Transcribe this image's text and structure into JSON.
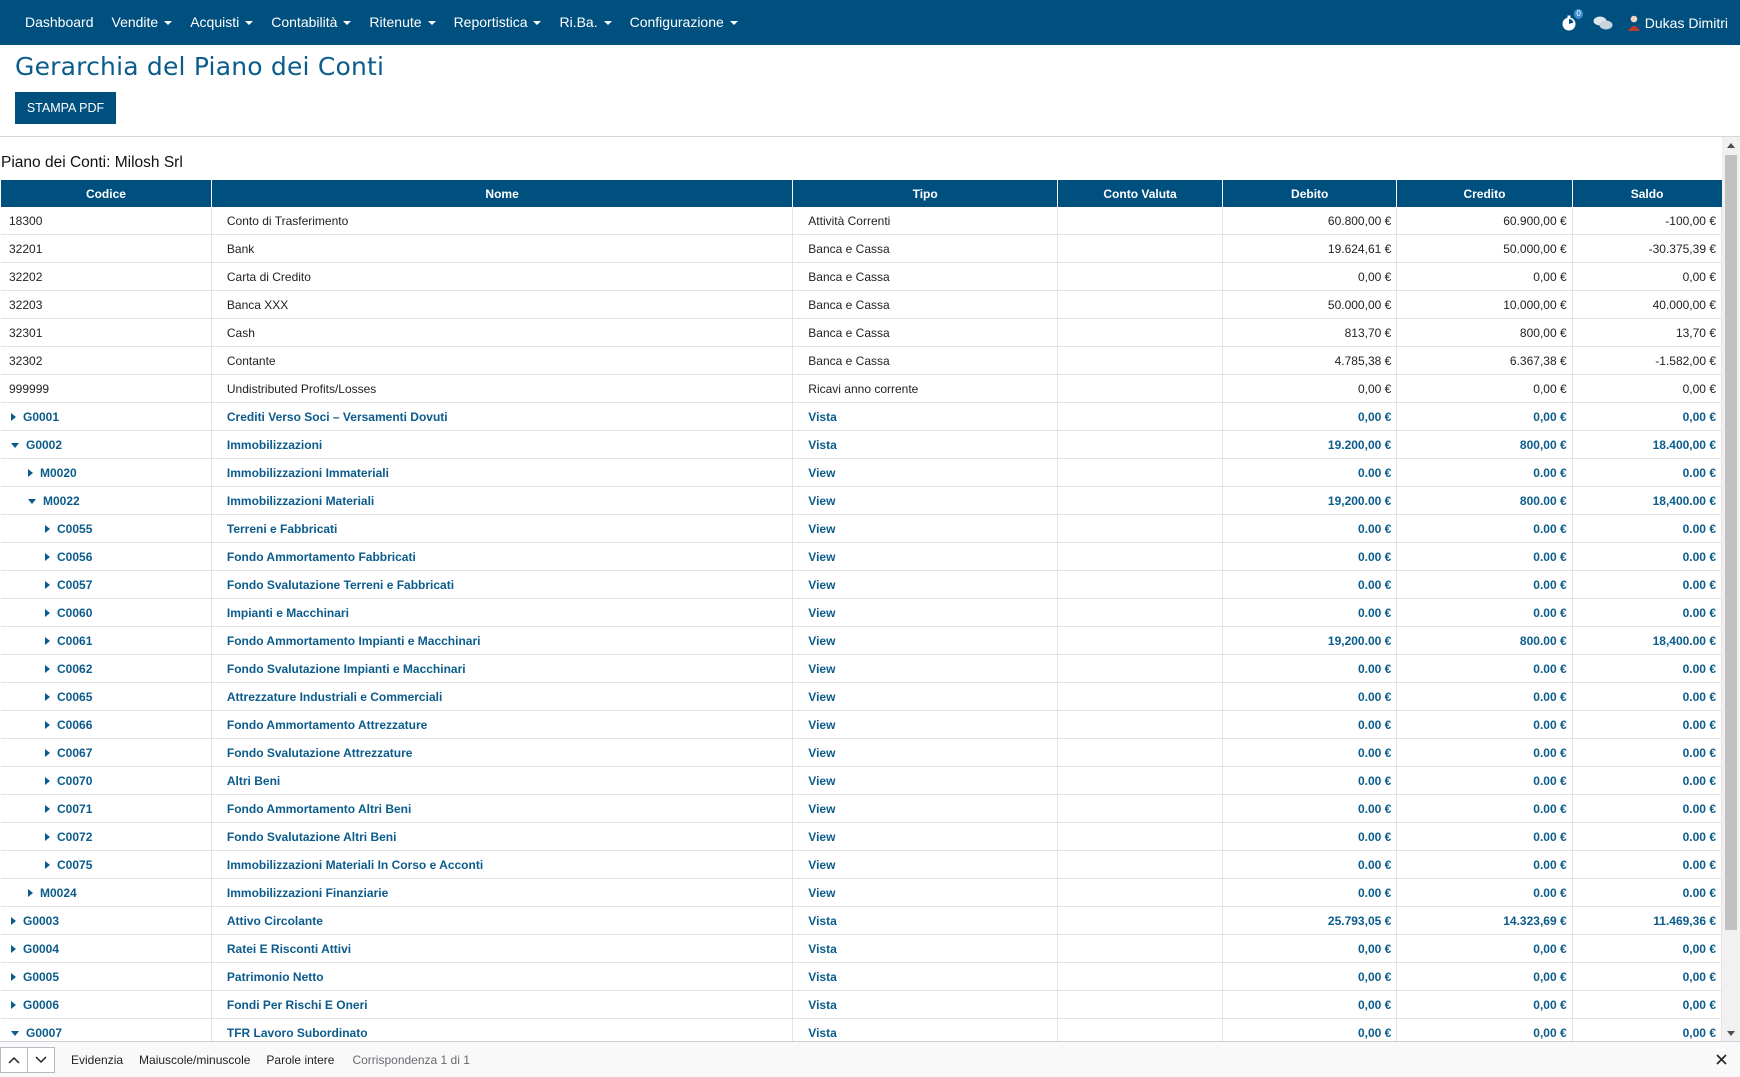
{
  "nav": {
    "items": [
      {
        "label": "Dashboard",
        "caret": false
      },
      {
        "label": "Vendite",
        "caret": true
      },
      {
        "label": "Acquisti",
        "caret": true
      },
      {
        "label": "Contabilità",
        "caret": true
      },
      {
        "label": "Ritenute",
        "caret": true
      },
      {
        "label": "Reportistica",
        "caret": true
      },
      {
        "label": "Ri.Ba.",
        "caret": true
      },
      {
        "label": "Configurazione",
        "caret": true
      }
    ],
    "user_name": "Dukas Dimitri",
    "notification_count": "0",
    "icons": [
      "timer-icon",
      "chat-icon",
      "user-avatar-icon"
    ]
  },
  "page": {
    "title": "Gerarchia del Piano dei Conti",
    "print_button": "STAMPA PDF",
    "section_title": "Piano dei Conti: Milosh Srl"
  },
  "table": {
    "headers": [
      "Codice",
      "Nome",
      "Tipo",
      "Conto Valuta",
      "Debito",
      "Credito",
      "Saldo"
    ],
    "rows": [
      {
        "level": 0,
        "toggle": "none",
        "group": false,
        "code": "18300",
        "name": "Conto di Trasferimento",
        "type": "Attività Correnti",
        "currency": "",
        "debit": "60.800,00 €",
        "credit": "60.900,00 €",
        "balance": "-100,00 €"
      },
      {
        "level": 0,
        "toggle": "none",
        "group": false,
        "code": "32201",
        "name": "Bank",
        "type": "Banca e Cassa",
        "currency": "",
        "debit": "19.624,61 €",
        "credit": "50.000,00 €",
        "balance": "-30.375,39 €"
      },
      {
        "level": 0,
        "toggle": "none",
        "group": false,
        "code": "32202",
        "name": "Carta di Credito",
        "type": "Banca e Cassa",
        "currency": "",
        "debit": "0,00 €",
        "credit": "0,00 €",
        "balance": "0,00 €"
      },
      {
        "level": 0,
        "toggle": "none",
        "group": false,
        "code": "32203",
        "name": "Banca XXX",
        "type": "Banca e Cassa",
        "currency": "",
        "debit": "50.000,00 €",
        "credit": "10.000,00 €",
        "balance": "40.000,00 €"
      },
      {
        "level": 0,
        "toggle": "none",
        "group": false,
        "code": "32301",
        "name": "Cash",
        "type": "Banca e Cassa",
        "currency": "",
        "debit": "813,70 €",
        "credit": "800,00 €",
        "balance": "13,70 €"
      },
      {
        "level": 0,
        "toggle": "none",
        "group": false,
        "code": "32302",
        "name": "Contante",
        "type": "Banca e Cassa",
        "currency": "",
        "debit": "4.785,38 €",
        "credit": "6.367,38 €",
        "balance": "-1.582,00 €"
      },
      {
        "level": 0,
        "toggle": "none",
        "group": false,
        "code": "999999",
        "name": "Undistributed Profits/Losses",
        "type": "Ricavi anno corrente",
        "currency": "",
        "debit": "0,00 €",
        "credit": "0,00 €",
        "balance": "0,00 €"
      },
      {
        "level": 0,
        "toggle": "right",
        "group": true,
        "code": "G0001",
        "name": "Crediti Verso Soci – Versamenti Dovuti",
        "type": "Vista",
        "currency": "",
        "debit": "0,00 €",
        "credit": "0,00 €",
        "balance": "0,00 €"
      },
      {
        "level": 0,
        "toggle": "down",
        "group": true,
        "code": "G0002",
        "name": "Immobilizzazioni",
        "type": "Vista",
        "currency": "",
        "debit": "19.200,00 €",
        "credit": "800,00 €",
        "balance": "18.400,00 €"
      },
      {
        "level": 1,
        "toggle": "right",
        "group": true,
        "code": "M0020",
        "name": "Immobilizzazioni Immateriali",
        "type": "View",
        "currency": "",
        "debit": "0.00 €",
        "credit": "0.00 €",
        "balance": "0.00 €"
      },
      {
        "level": 1,
        "toggle": "down",
        "group": true,
        "code": "M0022",
        "name": "Immobilizzazioni Materiali",
        "type": "View",
        "currency": "",
        "debit": "19,200.00 €",
        "credit": "800.00 €",
        "balance": "18,400.00 €"
      },
      {
        "level": 2,
        "toggle": "right",
        "group": true,
        "code": "C0055",
        "name": "Terreni e Fabbricati",
        "type": "View",
        "currency": "",
        "debit": "0.00 €",
        "credit": "0.00 €",
        "balance": "0.00 €"
      },
      {
        "level": 2,
        "toggle": "right",
        "group": true,
        "code": "C0056",
        "name": "Fondo Ammortamento Fabbricati",
        "type": "View",
        "currency": "",
        "debit": "0.00 €",
        "credit": "0.00 €",
        "balance": "0.00 €"
      },
      {
        "level": 2,
        "toggle": "right",
        "group": true,
        "code": "C0057",
        "name": "Fondo Svalutazione Terreni e Fabbricati",
        "type": "View",
        "currency": "",
        "debit": "0.00 €",
        "credit": "0.00 €",
        "balance": "0.00 €"
      },
      {
        "level": 2,
        "toggle": "right",
        "group": true,
        "code": "C0060",
        "name": "Impianti e Macchinari",
        "type": "View",
        "currency": "",
        "debit": "0.00 €",
        "credit": "0.00 €",
        "balance": "0.00 €"
      },
      {
        "level": 2,
        "toggle": "right",
        "group": true,
        "code": "C0061",
        "name": "Fondo Ammortamento Impianti e Macchinari",
        "type": "View",
        "currency": "",
        "debit": "19,200.00 €",
        "credit": "800.00 €",
        "balance": "18,400.00 €"
      },
      {
        "level": 2,
        "toggle": "right",
        "group": true,
        "code": "C0062",
        "name": "Fondo Svalutazione Impianti e Macchinari",
        "type": "View",
        "currency": "",
        "debit": "0.00 €",
        "credit": "0.00 €",
        "balance": "0.00 €"
      },
      {
        "level": 2,
        "toggle": "right",
        "group": true,
        "code": "C0065",
        "name": "Attrezzature Industriali e Commerciali",
        "type": "View",
        "currency": "",
        "debit": "0.00 €",
        "credit": "0.00 €",
        "balance": "0.00 €"
      },
      {
        "level": 2,
        "toggle": "right",
        "group": true,
        "code": "C0066",
        "name": "Fondo Ammortamento Attrezzature",
        "type": "View",
        "currency": "",
        "debit": "0.00 €",
        "credit": "0.00 €",
        "balance": "0.00 €"
      },
      {
        "level": 2,
        "toggle": "right",
        "group": true,
        "code": "C0067",
        "name": "Fondo Svalutazione Attrezzature",
        "type": "View",
        "currency": "",
        "debit": "0.00 €",
        "credit": "0.00 €",
        "balance": "0.00 €"
      },
      {
        "level": 2,
        "toggle": "right",
        "group": true,
        "code": "C0070",
        "name": "Altri Beni",
        "type": "View",
        "currency": "",
        "debit": "0.00 €",
        "credit": "0.00 €",
        "balance": "0.00 €"
      },
      {
        "level": 2,
        "toggle": "right",
        "group": true,
        "code": "C0071",
        "name": "Fondo Ammortamento Altri Beni",
        "type": "View",
        "currency": "",
        "debit": "0.00 €",
        "credit": "0.00 €",
        "balance": "0.00 €"
      },
      {
        "level": 2,
        "toggle": "right",
        "group": true,
        "code": "C0072",
        "name": "Fondo Svalutazione Altri Beni",
        "type": "View",
        "currency": "",
        "debit": "0.00 €",
        "credit": "0.00 €",
        "balance": "0.00 €"
      },
      {
        "level": 2,
        "toggle": "right",
        "group": true,
        "code": "C0075",
        "name": "Immobilizzazioni Materiali In Corso e Acconti",
        "type": "View",
        "currency": "",
        "debit": "0.00 €",
        "credit": "0.00 €",
        "balance": "0.00 €"
      },
      {
        "level": 1,
        "toggle": "right",
        "group": true,
        "code": "M0024",
        "name": "Immobilizzazioni Finanziarie",
        "type": "View",
        "currency": "",
        "debit": "0.00 €",
        "credit": "0.00 €",
        "balance": "0.00 €"
      },
      {
        "level": 0,
        "toggle": "right",
        "group": true,
        "code": "G0003",
        "name": "Attivo Circolante",
        "type": "Vista",
        "currency": "",
        "debit": "25.793,05 €",
        "credit": "14.323,69 €",
        "balance": "11.469,36 €"
      },
      {
        "level": 0,
        "toggle": "right",
        "group": true,
        "code": "G0004",
        "name": "Ratei E Risconti Attivi",
        "type": "Vista",
        "currency": "",
        "debit": "0,00 €",
        "credit": "0,00 €",
        "balance": "0,00 €"
      },
      {
        "level": 0,
        "toggle": "right",
        "group": true,
        "code": "G0005",
        "name": "Patrimonio Netto",
        "type": "Vista",
        "currency": "",
        "debit": "0,00 €",
        "credit": "0,00 €",
        "balance": "0,00 €"
      },
      {
        "level": 0,
        "toggle": "right",
        "group": true,
        "code": "G0006",
        "name": "Fondi Per Rischi E Oneri",
        "type": "Vista",
        "currency": "",
        "debit": "0,00 €",
        "credit": "0,00 €",
        "balance": "0,00 €"
      },
      {
        "level": 0,
        "toggle": "down",
        "group": true,
        "code": "G0007",
        "name": "TFR Lavoro Subordinato",
        "type": "Vista",
        "currency": "",
        "debit": "0,00 €",
        "credit": "0,00 €",
        "balance": "0,00 €"
      }
    ]
  },
  "findbar": {
    "highlight_label": "Evidenzia",
    "match_case_label": "Maiuscole/minuscole",
    "whole_words_label": "Parole intere",
    "status": "Corrispondenza 1 di 1"
  },
  "colors": {
    "brand": "#00507f",
    "link": "#0b5c8c"
  }
}
